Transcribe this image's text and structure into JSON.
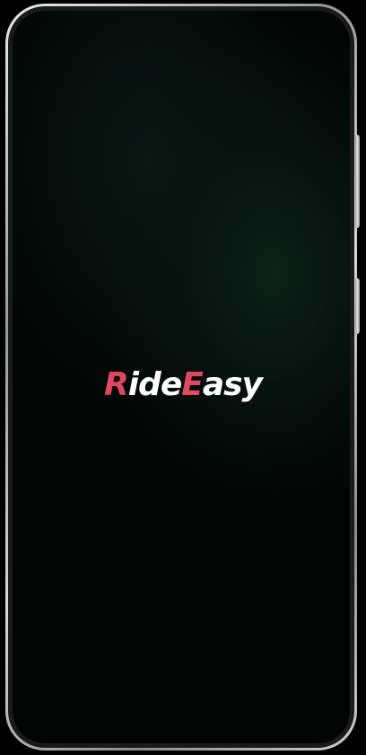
{
  "app": {
    "logo_parts": [
      {
        "text": "R",
        "accent": true
      },
      {
        "text": "ide",
        "accent": false
      },
      {
        "text": "E",
        "accent": true
      },
      {
        "text": "asy",
        "accent": false
      }
    ]
  },
  "colors": {
    "accent": "#e0485f",
    "text": "#ffffff",
    "background": "#020403"
  }
}
